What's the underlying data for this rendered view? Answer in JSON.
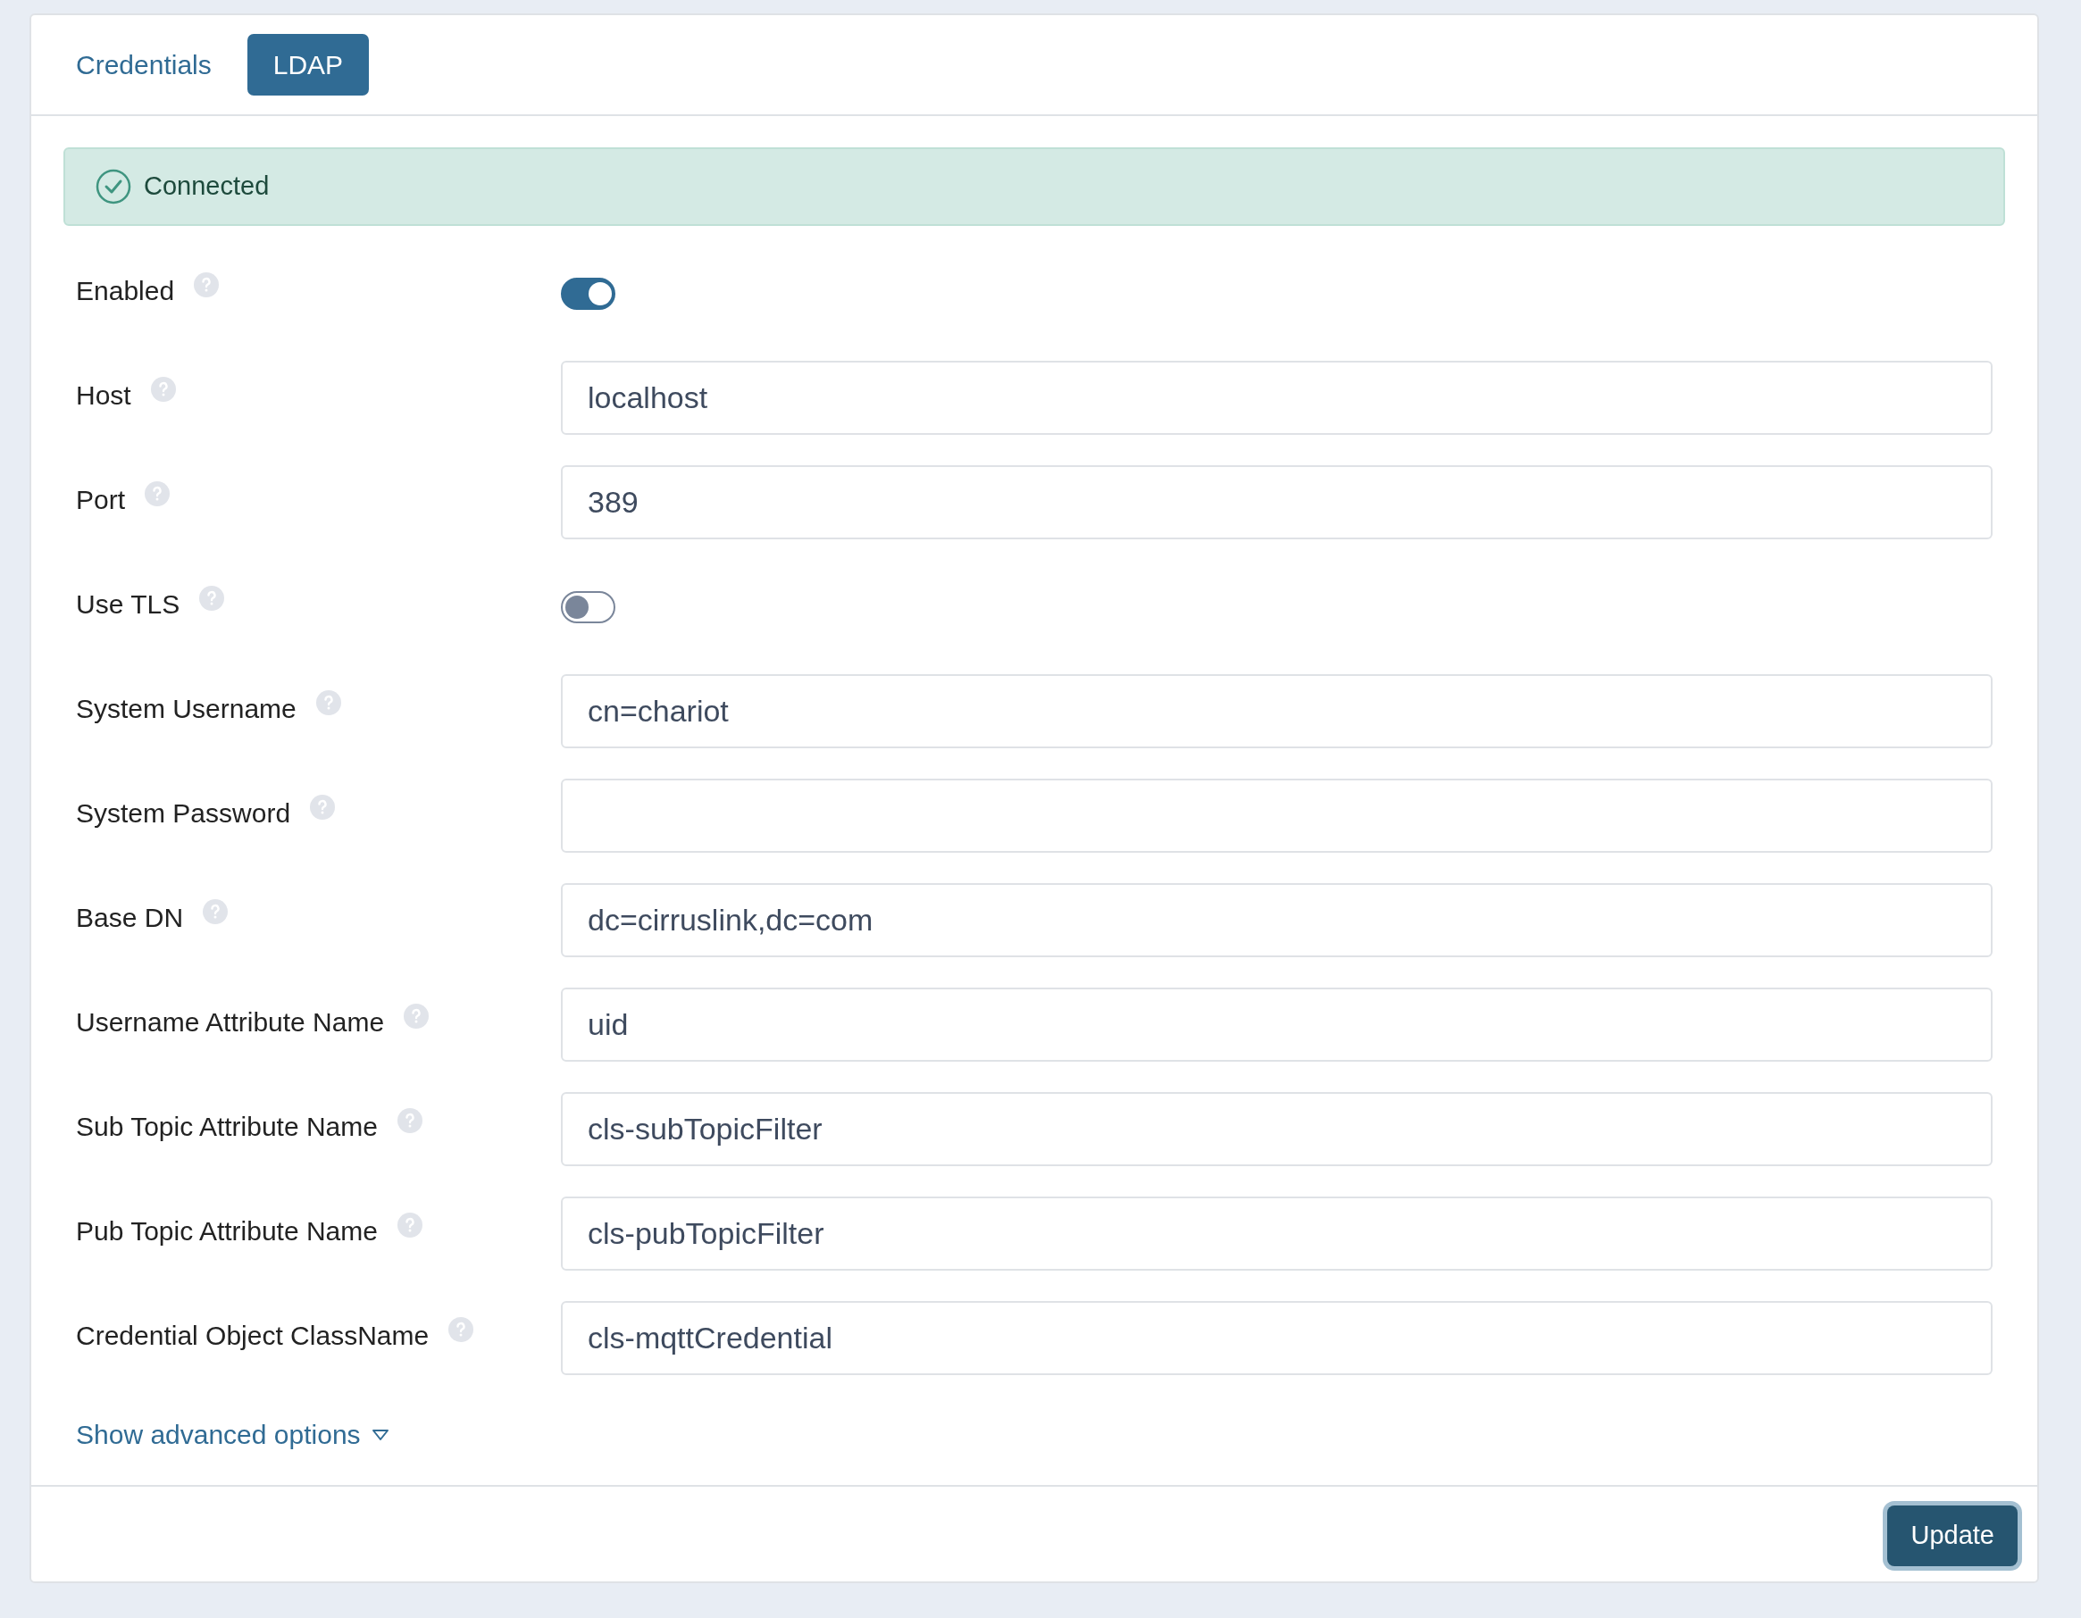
{
  "tabs": [
    {
      "label": "Credentials",
      "selected": false
    },
    {
      "label": "LDAP",
      "selected": true
    }
  ],
  "status": {
    "text": "Connected",
    "connected": true
  },
  "fields": [
    {
      "label": "Enabled",
      "kind": "toggle",
      "on": true
    },
    {
      "label": "Host",
      "kind": "text",
      "value": "localhost"
    },
    {
      "label": "Port",
      "kind": "text",
      "value": "389"
    },
    {
      "label": "Use TLS",
      "kind": "toggle",
      "on": false
    },
    {
      "label": "System Username",
      "kind": "text",
      "value": "cn=chariot"
    },
    {
      "label": "System Password",
      "kind": "password"
    },
    {
      "label": "Base DN",
      "kind": "text",
      "value": "dc=cirruslink,dc=com"
    },
    {
      "label": "Username Attribute Name",
      "kind": "text",
      "value": "uid"
    },
    {
      "label": "Sub Topic Attribute Name",
      "kind": "text",
      "value": "cls-subTopicFilter"
    },
    {
      "label": "Pub Topic Attribute Name",
      "kind": "text",
      "value": "cls-pubTopicFilter"
    },
    {
      "label": "Credential Object ClassName",
      "kind": "text",
      "value": "cls-mqttCredential"
    }
  ],
  "advanced_link": "Show advanced options",
  "submit_button": "Update"
}
